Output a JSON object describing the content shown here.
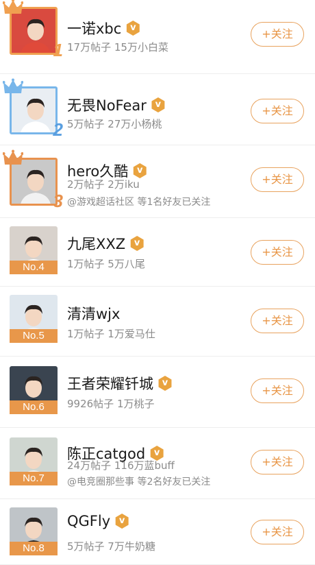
{
  "ranking": {
    "follow_label": "+关注",
    "accent_color": "#e8974a",
    "items": [
      {
        "rank": "1",
        "name": "一诺xbc",
        "verified": true,
        "stats": "17万帖子 15万小白菜",
        "friends": ""
      },
      {
        "rank": "2",
        "name": "无畏NoFear",
        "verified": true,
        "stats": "5万帖子 27万小杨桃",
        "friends": ""
      },
      {
        "rank": "3",
        "name": "hero久酷",
        "verified": true,
        "stats": "2万帖子 2万iku",
        "friends": "@游戏超话社区 等1名好友已关注"
      },
      {
        "rank": "No.4",
        "name": "九尾XXZ",
        "verified": true,
        "stats": "1万帖子 5万八尾",
        "friends": ""
      },
      {
        "rank": "No.5",
        "name": "清清wjx",
        "verified": false,
        "stats": "1万帖子 1万爱马仕",
        "friends": ""
      },
      {
        "rank": "No.6",
        "name": "王者荣耀钎城",
        "verified": true,
        "stats": "9926帖子 1万桃子",
        "friends": ""
      },
      {
        "rank": "No.7",
        "name": "陈正catgod",
        "verified": true,
        "stats": "24万帖子 116万蓝buff",
        "friends": "@电竞圈那些事 等2名好友已关注"
      },
      {
        "rank": "No.8",
        "name": "QGFly",
        "verified": true,
        "stats": "5万帖子 7万牛奶糖",
        "friends": ""
      }
    ]
  }
}
